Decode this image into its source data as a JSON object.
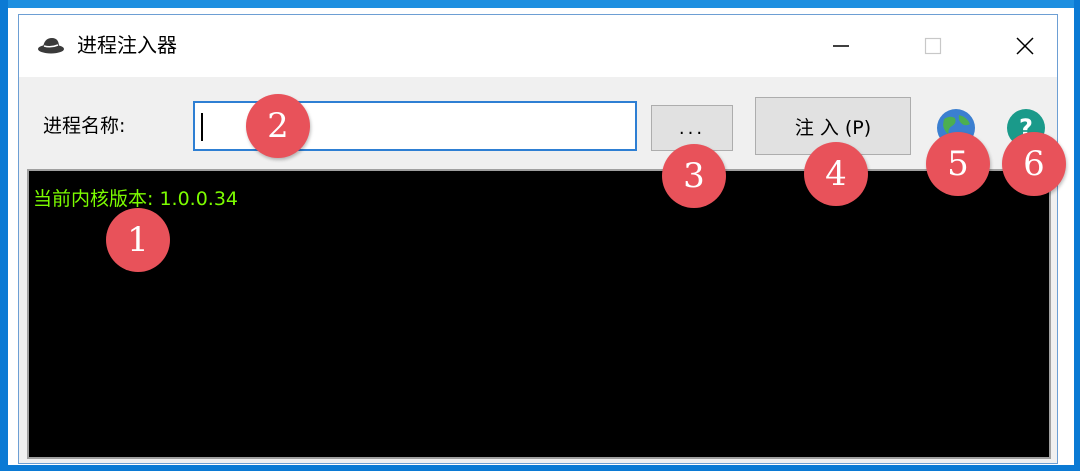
{
  "window": {
    "title": "进程注入器",
    "controls": {
      "minimize_icon": "minimize-icon",
      "maximize_icon": "maximize-icon",
      "close_icon": "close-icon"
    }
  },
  "toolbar": {
    "process_label": "进程名称:",
    "process_input_value": "",
    "browse_label": "...",
    "inject_label": "注 入 (P)",
    "globe_icon": "globe-icon",
    "help_icon": "help-icon"
  },
  "console": {
    "line1": "当前内核版本: 1.0.0.34",
    "text_color": "#7cfc00",
    "background": "#000000"
  },
  "callouts": [
    "1",
    "2",
    "3",
    "4",
    "5",
    "6"
  ],
  "colors": {
    "callout": "#e8525a",
    "input_border": "#2e7fd3",
    "desktop": "#0b7ad4"
  }
}
